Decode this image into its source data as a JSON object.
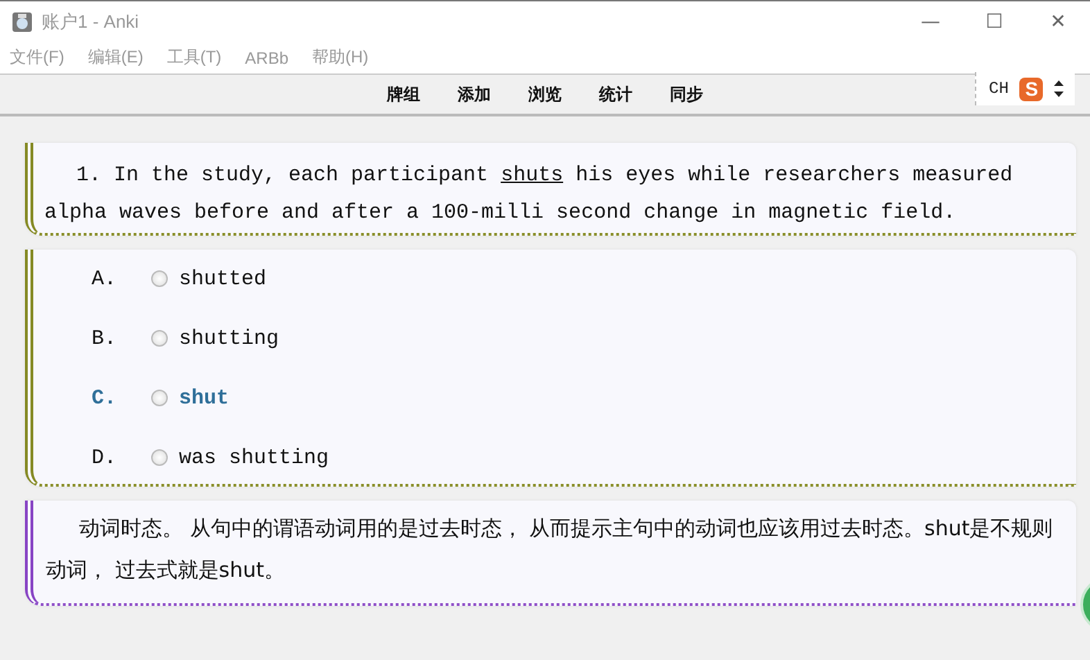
{
  "window": {
    "title": "账户1 - Anki",
    "controls": [
      "—",
      "☐",
      "✕"
    ]
  },
  "menu": [
    "文件(F)",
    "编辑(E)",
    "工具(T)",
    "ARBb",
    "帮助(H)"
  ],
  "toolbar": [
    "牌组",
    "添加",
    "浏览",
    "统计",
    "同步"
  ],
  "ime": {
    "label": "CH",
    "logo": "S"
  },
  "question": {
    "before": "1. In the study, each participant ",
    "underlined": "shuts",
    "after": " his eyes while researchers measured alpha waves before and after a 100-milli second change in magnetic field."
  },
  "options": [
    {
      "letter": "A.",
      "text": "shutted",
      "selected": false,
      "correct": false
    },
    {
      "letter": "B.",
      "text": "shutting",
      "selected": false,
      "correct": false
    },
    {
      "letter": "C.",
      "text": "shut",
      "selected": false,
      "correct": true
    },
    {
      "letter": "D.",
      "text": "was shutting",
      "selected": false,
      "correct": false
    }
  ],
  "explanation": "动词时态。 从句中的谓语动词用的是过去时态， 从而提示主句中的动词也应该用过去时态。shut是不规则动词， 过去式就是shut。"
}
